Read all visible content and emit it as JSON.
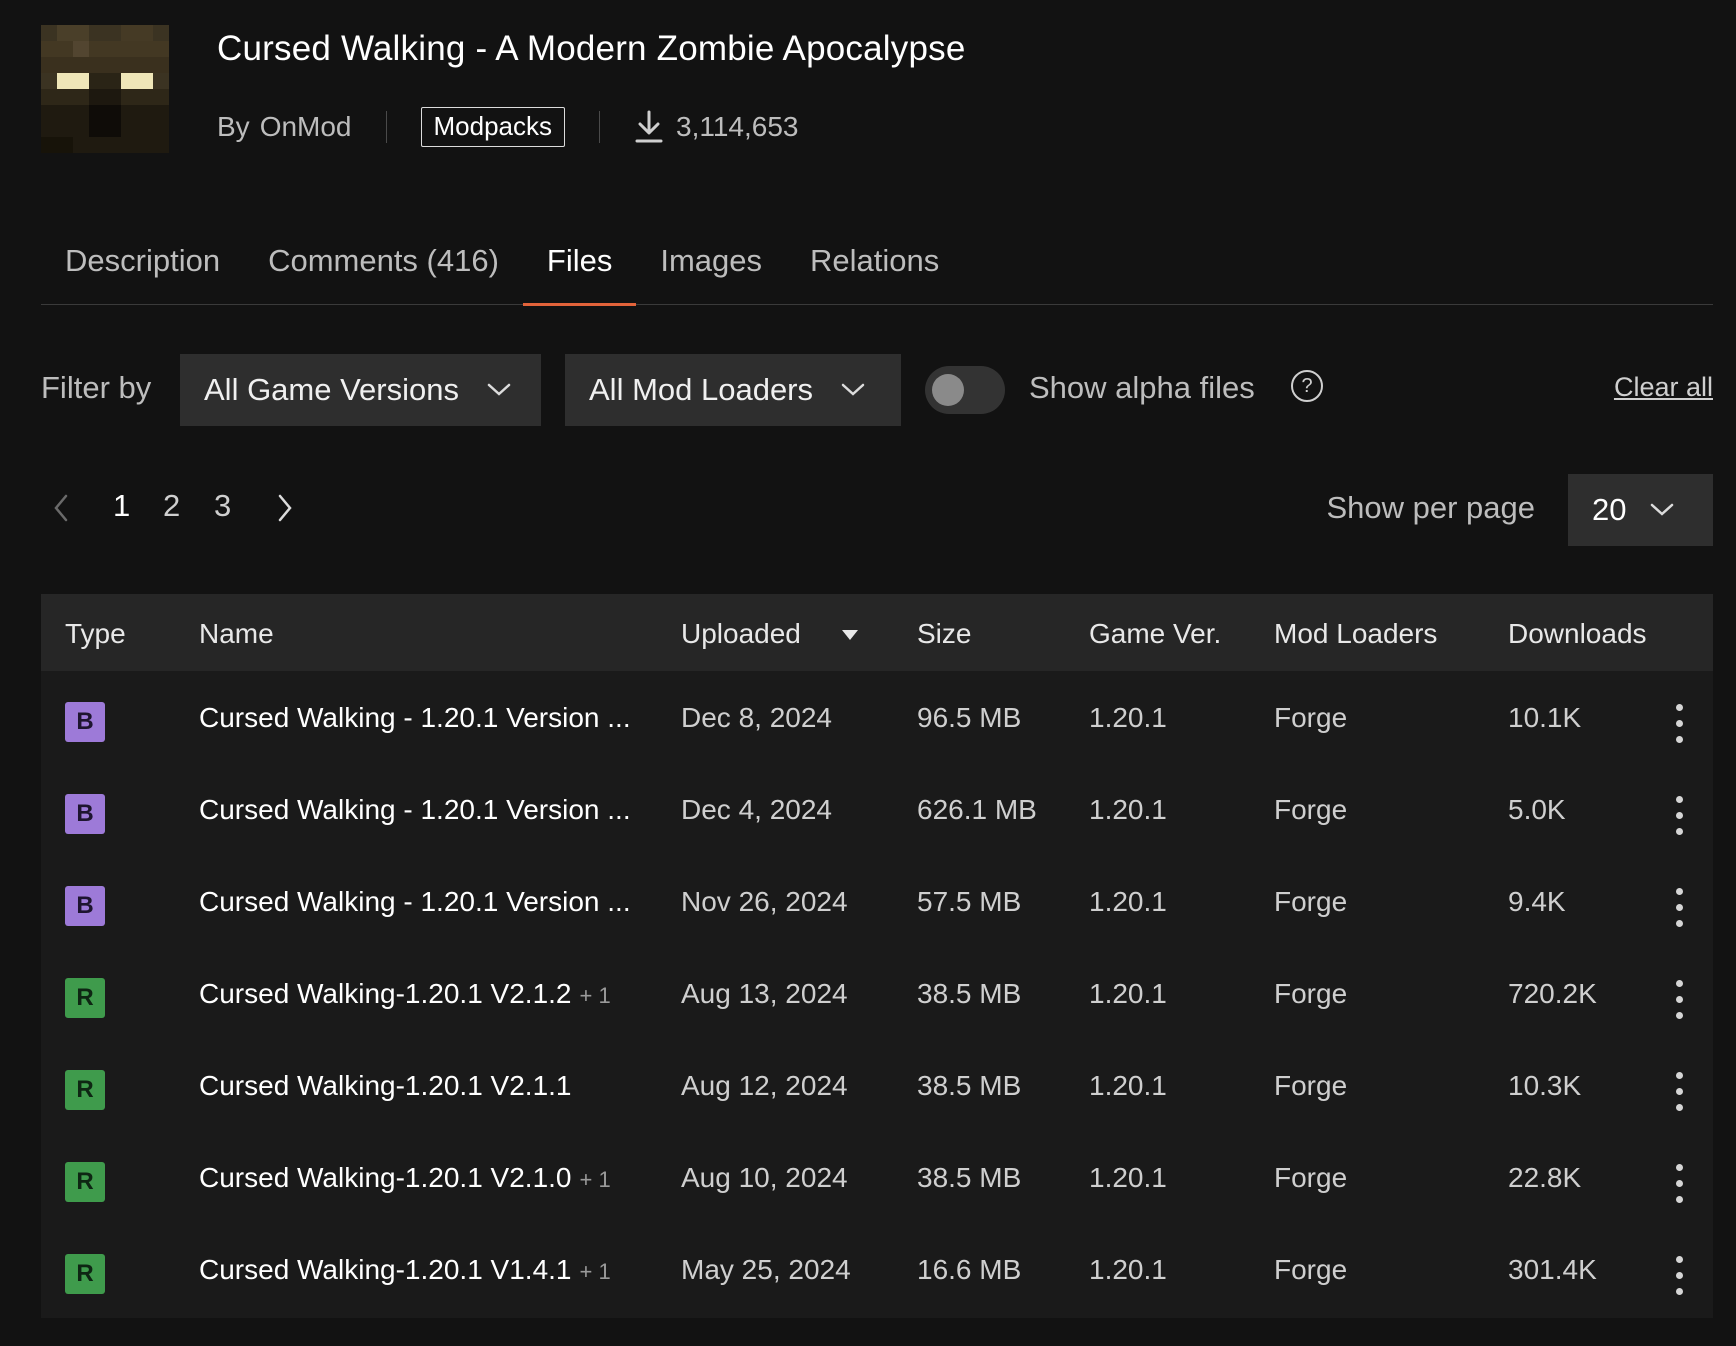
{
  "project": {
    "title": "Cursed Walking - A Modern Zombie Apocalypse",
    "by_label": "By",
    "author": "OnMod",
    "category": "Modpacks",
    "downloads": "3,114,653"
  },
  "tabs": [
    {
      "label": "Description",
      "active": false
    },
    {
      "label": "Comments (416)",
      "active": false
    },
    {
      "label": "Files",
      "active": true
    },
    {
      "label": "Images",
      "active": false
    },
    {
      "label": "Relations",
      "active": false
    }
  ],
  "filters": {
    "label": "Filter by",
    "game_versions": "All Game Versions",
    "mod_loaders": "All Mod Loaders",
    "alpha_toggle_label": "Show alpha files",
    "alpha_toggle_on": false,
    "help": "?",
    "clear_all": "Clear all"
  },
  "pagination": {
    "pages": [
      "1",
      "2",
      "3"
    ],
    "current": "1",
    "per_page_label": "Show per page",
    "per_page": "20"
  },
  "table": {
    "headers": {
      "type": "Type",
      "name": "Name",
      "uploaded": "Uploaded",
      "size": "Size",
      "game_ver": "Game Ver.",
      "mod_loaders": "Mod Loaders",
      "downloads": "Downloads"
    },
    "rows": [
      {
        "type": "B",
        "name": "Cursed Walking - 1.20.1 Version ...",
        "extra": "",
        "uploaded": "Dec 8, 2024",
        "size": "96.5 MB",
        "game_ver": "1.20.1",
        "loader": "Forge",
        "downloads": "10.1K"
      },
      {
        "type": "B",
        "name": "Cursed Walking - 1.20.1 Version ...",
        "extra": "",
        "uploaded": "Dec 4, 2024",
        "size": "626.1 MB",
        "game_ver": "1.20.1",
        "loader": "Forge",
        "downloads": "5.0K"
      },
      {
        "type": "B",
        "name": "Cursed Walking - 1.20.1 Version ...",
        "extra": "",
        "uploaded": "Nov 26, 2024",
        "size": "57.5 MB",
        "game_ver": "1.20.1",
        "loader": "Forge",
        "downloads": "9.4K"
      },
      {
        "type": "R",
        "name": "Cursed Walking-1.20.1 V2.1.2",
        "extra": "+ 1",
        "uploaded": "Aug 13, 2024",
        "size": "38.5 MB",
        "game_ver": "1.20.1",
        "loader": "Forge",
        "downloads": "720.2K"
      },
      {
        "type": "R",
        "name": "Cursed Walking-1.20.1 V2.1.1",
        "extra": "",
        "uploaded": "Aug 12, 2024",
        "size": "38.5 MB",
        "game_ver": "1.20.1",
        "loader": "Forge",
        "downloads": "10.3K"
      },
      {
        "type": "R",
        "name": "Cursed Walking-1.20.1 V2.1.0",
        "extra": "+ 1",
        "uploaded": "Aug 10, 2024",
        "size": "38.5 MB",
        "game_ver": "1.20.1",
        "loader": "Forge",
        "downloads": "22.8K"
      },
      {
        "type": "R",
        "name": "Cursed Walking-1.20.1 V1.4.1",
        "extra": "+ 1",
        "uploaded": "May 25, 2024",
        "size": "16.6 MB",
        "game_ver": "1.20.1",
        "loader": "Forge",
        "downloads": "301.4K"
      }
    ]
  },
  "icons": {
    "download": "download-icon",
    "chevron": "chevron-down-icon",
    "prev": "chevron-left-icon",
    "next": "chevron-right-icon",
    "sort": "sort-desc-icon",
    "menu": "kebab-menu-icon",
    "help": "help-circle-icon"
  },
  "colors": {
    "background": "#121212",
    "accent": "#e2633a",
    "beta_badge": "#9d7ad8",
    "release_badge": "#3f9b4c"
  }
}
